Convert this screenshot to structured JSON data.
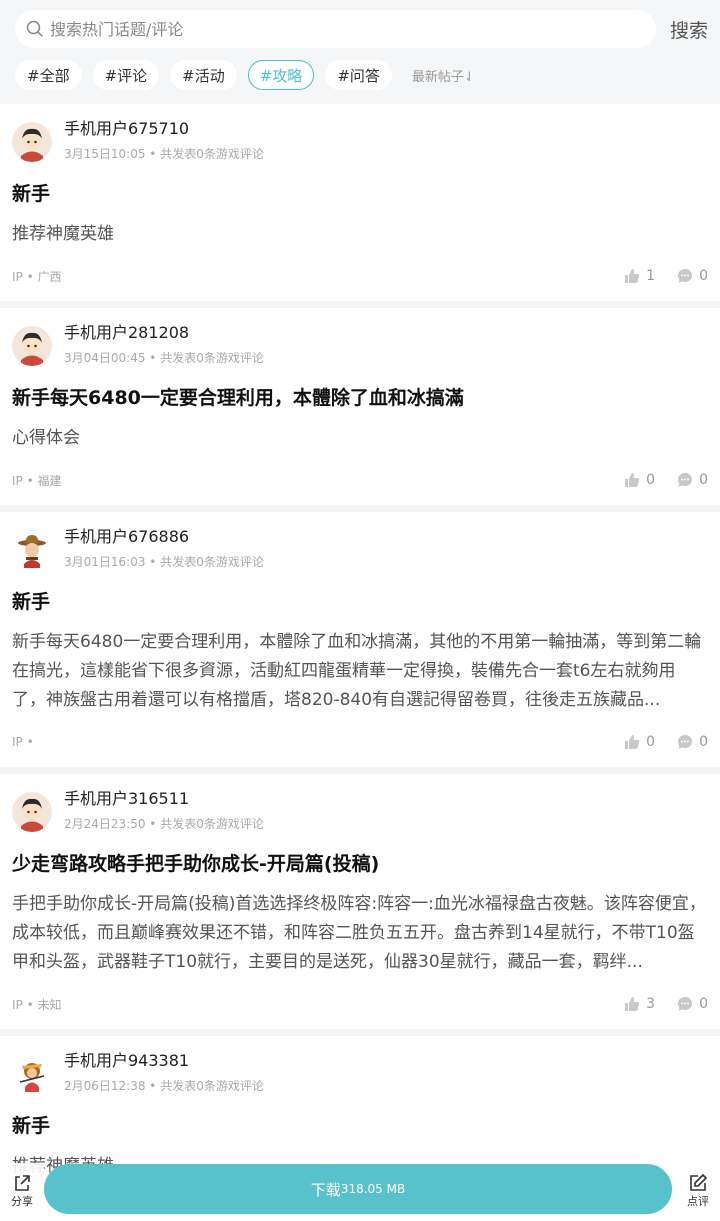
{
  "search": {
    "placeholder": "搜索热门话题/评论",
    "button_label": "搜索"
  },
  "tags": [
    {
      "label": "#全部",
      "active": false
    },
    {
      "label": "#评论",
      "active": false
    },
    {
      "label": "#活动",
      "active": false
    },
    {
      "label": "#攻略",
      "active": true
    },
    {
      "label": "#问答",
      "active": false
    }
  ],
  "sort_label": "最新帖子⇃",
  "colors": {
    "accent": "#4fbfc9",
    "download_bg": "#57c2cc"
  },
  "posts": [
    {
      "username": "手机用户675710",
      "meta": "3月15日10:05 • 共发表0条游戏评论",
      "title": "新手",
      "body": "推荐神魔英雄",
      "ip": "IP • 广西",
      "likes": "1",
      "comments": "0",
      "avatar": "boy-avatar-icon"
    },
    {
      "username": "手机用户281208",
      "meta": "3月04日00:45 • 共发表0条游戏评论",
      "title": "新手每天6480一定要合理利用，本體除了血和冰搞滿",
      "body": "心得体会",
      "ip": "IP • 福建",
      "likes": "0",
      "comments": "0",
      "avatar": "boy-avatar-icon"
    },
    {
      "username": "手机用户676886",
      "meta": "3月01日16:03 • 共发表0条游戏评论",
      "title": "新手",
      "body": "新手每天6480一定要合理利用，本體除了血和冰搞滿，其他的不用第一輪抽滿，等到第二輪在搞光，這樣能省下很多資源，活動紅四龍蛋精華一定得換，裝備先合一套t6左右就夠用了，神族盤古用着還可以有格擋盾，塔820-840有自選記得留卷買，往後走五族藏品...",
      "ip": "IP •",
      "likes": "0",
      "comments": "0",
      "avatar": "cowboy-avatar-icon"
    },
    {
      "username": "手机用户316511",
      "meta": "2月24日23:50 • 共发表0条游戏评论",
      "title": "少走弯路攻略手把手助你成长-开局篇(投稿)",
      "body": "手把手助你成长-开局篇(投稿)首选选择终极阵容:阵容一:血光冰福禄盘古夜魅。该阵容便宜，成本较低，而且巅峰赛效果还不错，和阵容二胜负五五开。盘古养到14星就行，不带T10盔甲和头盔，武器鞋子T10就行，主要目的是送死，仙器30星就行，藏品一套，羁绊...",
      "ip": "IP • 未知",
      "likes": "3",
      "comments": "0",
      "avatar": "boy-avatar-icon"
    },
    {
      "username": "手机用户943381",
      "meta": "2月06日12:38 • 共发表0条游戏评论",
      "title": "新手",
      "body": "推荐神魔英雄",
      "ip": "",
      "likes": "",
      "comments": "",
      "avatar": "monkey-avatar-icon"
    }
  ],
  "bottom": {
    "share_label": "分享",
    "download_label": "下载",
    "download_size": "318.05 MB",
    "review_label": "点评"
  }
}
